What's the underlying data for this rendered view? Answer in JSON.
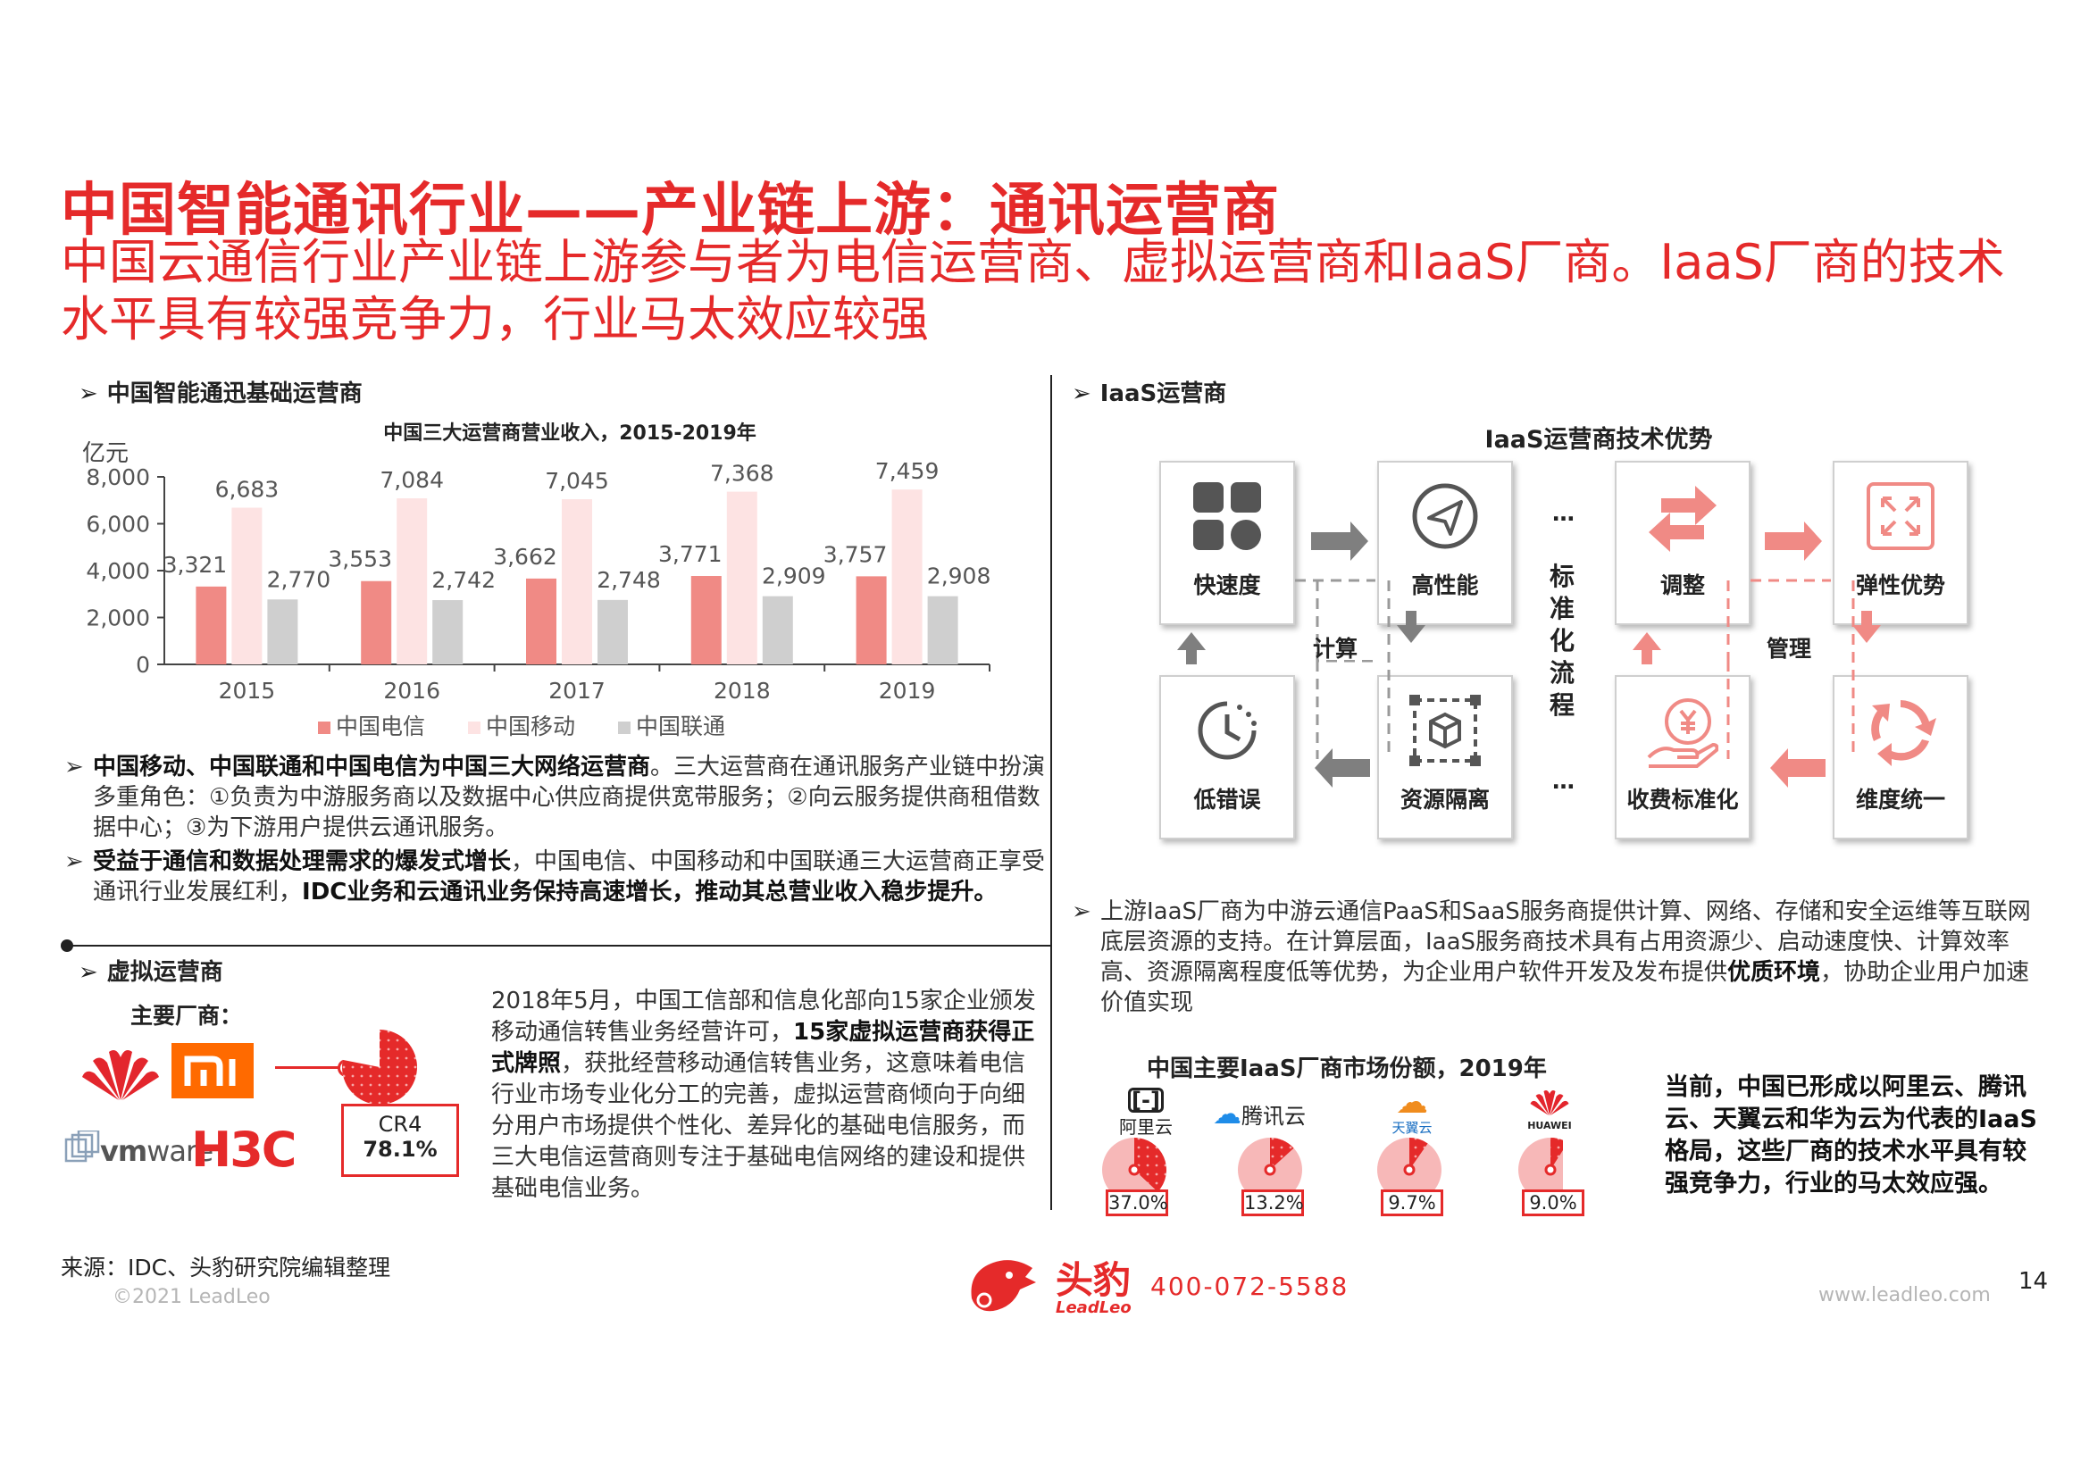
{
  "title": "中国智能通讯行业——产业链上游：通讯运营商",
  "subtitle": "中国云通信行业产业链上游参与者为电信运营商、虚拟运营商和IaaS厂商。IaaS厂商的技术水平具有较强竞争力，行业马太效应较强",
  "left": {
    "section1": "中国智能通迅基础运营商",
    "section2": "虚拟运营商",
    "bullets": [
      {
        "bold": "中国移动、中国联通和中国电信为中国三大网络运营商",
        "text": "。三大运营商在通讯服务产业链中扮演多重角色：①负责为中游服务商以及数据中心供应商提供宽带服务；②向云服务提供商租借数据中心；③为下游用户提供云通讯服务。"
      },
      {
        "bold": "受益于通信和数据处理需求的爆发式增长",
        "text": "，中国电信、中国移动和中国联通三大运营商正享受通讯行业发展红利，",
        "bold2": "IDC业务和云通讯业务保持高速增长，推动其总营业收入稳步提升。"
      }
    ],
    "main_vendors_label": "主要厂商：",
    "cr4_label": "CR4",
    "cr4_value": "78.1%",
    "cr4_fraction": 0.781,
    "virtual_text": {
      "part1": "2018年5月，中国工信部和信息化部向15家企业颁发移动通信转售业务经营许可，",
      "bold": "15家虚拟运营商获得正式牌照",
      "part2": "，获批经营移动通信转售业务，这意味着电信行业市场专业化分工的完善，虚拟运营商倾向于向细分用户市场提供个性化、差异化的基础电信服务，而三大电信运营商则专注于基础电信网络的建设和提供基础电信业务。"
    }
  },
  "chart_data": {
    "type": "bar",
    "title": "中国三大运营商营业收入，2015-2019年",
    "ylabel": "亿元",
    "categories": [
      "2015",
      "2016",
      "2017",
      "2018",
      "2019"
    ],
    "ylim": [
      0,
      8000
    ],
    "yticks": [
      "8,000",
      "6,000",
      "4,000",
      "2,000",
      "0"
    ],
    "series": [
      {
        "name": "中国电信",
        "color": "#f08a85",
        "values": [
          3321,
          3553,
          3662,
          3771,
          3757
        ],
        "labels": [
          "3,321",
          "3,553",
          "3,662",
          "3,771",
          "3,757"
        ]
      },
      {
        "name": "中国移动",
        "color": "#fde3e3",
        "values": [
          6683,
          7084,
          7045,
          7368,
          7459
        ],
        "labels": [
          "6,683",
          "7,084",
          "7,045",
          "7,368",
          "7,459"
        ]
      },
      {
        "name": "中国联通",
        "color": "#cfcfcf",
        "values": [
          2770,
          2742,
          2748,
          2909,
          2908
        ],
        "labels": [
          "2,770",
          "2,742",
          "2,748",
          "2,909",
          "2,908"
        ]
      }
    ],
    "legend_position": "bottom"
  },
  "right": {
    "section": "IaaS运营商",
    "diagram_title": "IaaS运营商技术优势",
    "boxes": {
      "speed": "快速度",
      "performance": "高性能",
      "low_error": "低错误",
      "isolation": "资源隔离",
      "adjust": "调整",
      "elastic": "弹性优势",
      "billing": "收费标准化",
      "unify": "维度统一"
    },
    "compute_label": "计算",
    "manage_label": "管理",
    "ellipsis": "…",
    "vertical_label": [
      "标",
      "准",
      "化",
      "流",
      "程"
    ],
    "paragraph": {
      "text": "上游IaaS厂商为中游云通信PaaS和SaaS服务商提供计算、网络、存储和安全运维等互联网底层资源的支持。在计算层面，IaaS服务商技术具有占用资源少、启动速度快、计算效率高、资源隔离程度低等优势，为企业用户软件开发及发布提供",
      "bold": "优质环境",
      "tail": "，协助企业用户加速价值实现"
    },
    "share_title": "中国主要IaaS厂商市场份额，2019年",
    "shares": [
      {
        "name": "阿里云",
        "value": "37.0%",
        "fraction": 0.37
      },
      {
        "name": "腾讯云",
        "value": "13.2%",
        "fraction": 0.132
      },
      {
        "name": "天翼云",
        "value": "9.7%",
        "fraction": 0.097
      },
      {
        "name": "HUAWEI",
        "value": "9.0%",
        "fraction": 0.09
      }
    ],
    "summary": "当前，中国已形成以阿里云、腾讯云、天翼云和华为云为代表的IaaS格局，这些厂商的技术水平具有较强竞争力，行业的马太效应强。"
  },
  "footer": {
    "source": "来源：IDC、头豹研究院编辑整理",
    "copyright": "©2021 LeadLeo",
    "brand_cn": "头豹",
    "brand_en": "LeadLeo",
    "phone": "400-072-5588",
    "website": "www.leadleo.com",
    "page": "14"
  },
  "colors": {
    "accent": "#e52a2a",
    "pink": "#f08a85"
  }
}
